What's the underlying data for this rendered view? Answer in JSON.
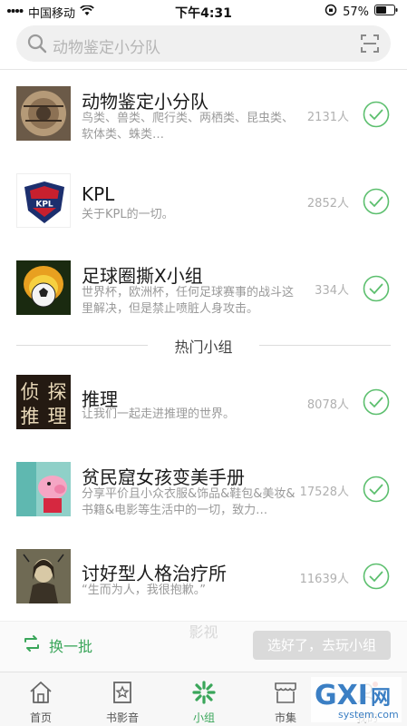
{
  "status_bar": {
    "carrier": "中国移动",
    "time": "下午4:31",
    "battery": "57%"
  },
  "search": {
    "placeholder": "动物鉴定小分队"
  },
  "my_groups": [
    {
      "title": "动物鉴定小分队",
      "desc": "鸟类、兽类、爬行类、两栖类、昆虫类、软体类、蛛类…",
      "count": "2131人",
      "avatar": "animal-wheel"
    },
    {
      "title": "KPL",
      "desc": "关于KPL的一切。",
      "count": "2852人",
      "avatar": "kpl-logo"
    },
    {
      "title": "足球圈撕X小组",
      "desc": "世界杯，欧洲杯，任何足球赛事的战斗这里解决，但是禁止喷脏人身攻击。",
      "count": "334人",
      "avatar": "flaming-football"
    }
  ],
  "section_title": "热门小组",
  "hot_groups": [
    {
      "title": "推理",
      "desc": "让我们一起走进推理的世界。",
      "count": "8078人",
      "avatar_text": "侦探推理"
    },
    {
      "title": "贫民窟女孩变美手册",
      "desc": "分享平价且小众衣服&饰品&鞋包&美妆&书籍&电影等生活中的一切，致力…",
      "count": "17528人",
      "avatar": "peppa-pig"
    },
    {
      "title": "讨好型人格治疗所",
      "desc": "“生而为人，我很抱歉。”",
      "count": "11639人",
      "avatar": "mona-lisa"
    }
  ],
  "bottom": {
    "ghost_text": "影视",
    "shuffle_label": "换一批",
    "go_label": "选好了，去玩小组"
  },
  "tabs": [
    {
      "label": "首页",
      "icon": "home-icon"
    },
    {
      "label": "书影音",
      "icon": "book-star-icon"
    },
    {
      "label": "小组",
      "icon": "group-icon",
      "active": true
    },
    {
      "label": "市集",
      "icon": "shop-icon"
    },
    {
      "label": "我的",
      "icon": "profile-icon"
    }
  ],
  "watermark": {
    "text": "GXI网",
    "sub": "system.com"
  },
  "colors": {
    "accent": "#3aa65a",
    "check": "#5cbf6e"
  }
}
